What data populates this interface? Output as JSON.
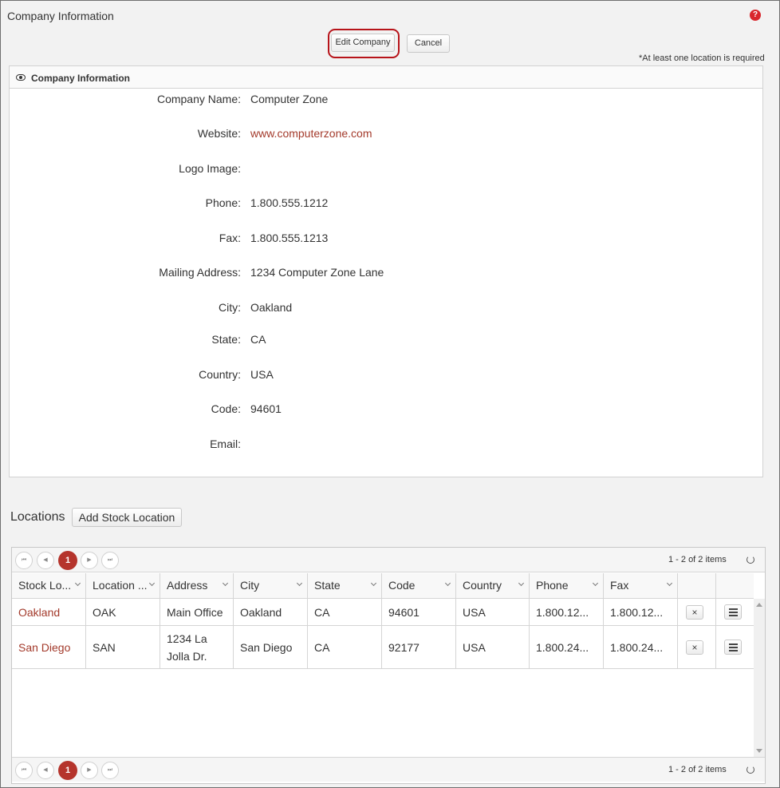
{
  "page": {
    "title": "Company Information",
    "help_glyph": "?",
    "edit_label": "Edit Company",
    "cancel_label": "Cancel",
    "required_note": "*At least one location is required"
  },
  "panel": {
    "title": "Company Information",
    "fields": [
      {
        "label": "Company Name:",
        "value": "Computer Zone"
      },
      {
        "label": "Website:",
        "value": "www.computerzone.com"
      },
      {
        "label": "Logo Image:",
        "value": ""
      },
      {
        "label": "Phone:",
        "value": "1.800.555.1212"
      },
      {
        "label": "Fax:",
        "value": "1.800.555.1213"
      },
      {
        "label": "Mailing Address:",
        "value": "1234 Computer Zone Lane"
      },
      {
        "label": "City:",
        "value": "Oakland"
      },
      {
        "label": "State:",
        "value": "CA"
      },
      {
        "label": "Country:",
        "value": "USA"
      },
      {
        "label": "Code:",
        "value": "94601"
      },
      {
        "label": "Email:",
        "value": ""
      }
    ]
  },
  "locations": {
    "title": "Locations",
    "add_label": "Add Stock Location",
    "pager": {
      "current_page": "1",
      "info": "1 - 2 of 2 items",
      "first_glyph": "⏮",
      "prev_glyph": "◀",
      "next_glyph": "▶",
      "last_glyph": "⏭"
    },
    "columns": [
      "Stock Lo...",
      "Location ...",
      "Address",
      "City",
      "State",
      "Code",
      "Country",
      "Phone",
      "Fax"
    ],
    "rows": [
      {
        "stock_location": "Oakland",
        "location_code": "OAK",
        "address": "Main Office",
        "city": "Oakland",
        "state": "CA",
        "code": "94601",
        "country": "USA",
        "phone": "1.800.12...",
        "fax": "1.800.12..."
      },
      {
        "stock_location": "San Diego",
        "location_code": "SAN",
        "address": "1234 La Jolla Dr.",
        "city": "San Diego",
        "state": "CA",
        "code": "92177",
        "country": "USA",
        "phone": "1.800.24...",
        "fax": "1.800.24..."
      }
    ],
    "delete_glyph": "×"
  },
  "colors": {
    "accent": "#b5342c",
    "link": "#a33a2b",
    "highlight_ring": "#b7141a"
  }
}
